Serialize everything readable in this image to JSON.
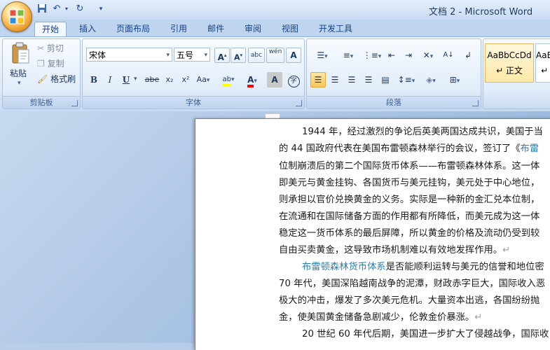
{
  "window": {
    "title": "文档 2 - Microsoft Word"
  },
  "qat": {
    "save": "save-icon",
    "undo": "undo-icon",
    "redo": "redo-icon",
    "customize": "customize-icon"
  },
  "tabs": [
    {
      "label": "开始"
    },
    {
      "label": "插入"
    },
    {
      "label": "页面布局"
    },
    {
      "label": "引用"
    },
    {
      "label": "邮件"
    },
    {
      "label": "审阅"
    },
    {
      "label": "视图"
    },
    {
      "label": "开发工具"
    }
  ],
  "active_tab": "开始",
  "clipboard": {
    "label": "剪贴板",
    "paste": "粘贴",
    "cut": "剪切",
    "copy": "复制",
    "format_painter": "格式刷"
  },
  "font": {
    "label": "字体",
    "font_name": "宋体",
    "font_size": "五号",
    "grow": "A",
    "shrink": "A",
    "clear_format": "abc",
    "phonetic": "wén",
    "border_char": "A",
    "bold": "B",
    "italic": "I",
    "underline": "U",
    "strike": "abe",
    "subscript": "x₂",
    "superscript": "x²",
    "change_case": "Aa",
    "highlight": "ab",
    "font_color": "A",
    "char_shading": "A",
    "enclose": "字"
  },
  "paragraph": {
    "label": "段落"
  },
  "styles": [
    {
      "sample": "AaBbCcDd",
      "name": "↵ 正文"
    },
    {
      "sample": "AaBbCc",
      "name": "↵ 无"
    }
  ],
  "colors": {
    "accent": "#15428b",
    "link": "#2e7fa8",
    "highlight": "#ffff00",
    "font_red": "#ff0000"
  },
  "document": {
    "lines": [
      {
        "text": "1944 年，经过激烈的争论后英美两国达成共识，美国于当"
      },
      {
        "text": "的 44 国政府代表在美国布雷顿森林举行的会议，签订了《",
        "link": "布雷"
      },
      {
        "text": "位制崩溃后的第二个国际货币体系——布雷顿森林体系。这一体"
      },
      {
        "text": "即美元与黄金挂钩、各国货币与美元挂钩，美元处于中心地位，"
      },
      {
        "text": "则承担以官价兑换黄金的义务。实际是一种新的金汇兑本位制，"
      },
      {
        "text": "在流通和在国际储备方面的作用都有所降低，而美元成为这一体"
      },
      {
        "text": "稳定这一货币体系的最后屏障，所以黄金的价格及流动仍受到较"
      },
      {
        "text": "自由买卖黄金，这导致市场机制难以有效地发挥作用。",
        "mark": "↵"
      },
      {
        "link": "布雷顿森林货币体系",
        "text": "是否能顺利运转与美元的信誉和地位密"
      },
      {
        "text": "70 年代，美国深陷越南战争的泥潭，财政赤字巨大，国际收入恶"
      },
      {
        "text": "极大的冲击，爆发了多次美元危机。大量资本出逃，各国纷纷抛"
      },
      {
        "text": "金，使美国黄金储备急剧减少，伦敦金价暴涨。",
        "mark": "↵"
      },
      {
        "text": "20 世纪 60 年代后期，美国进一步扩大了侵越战争，国际收"
      }
    ]
  }
}
